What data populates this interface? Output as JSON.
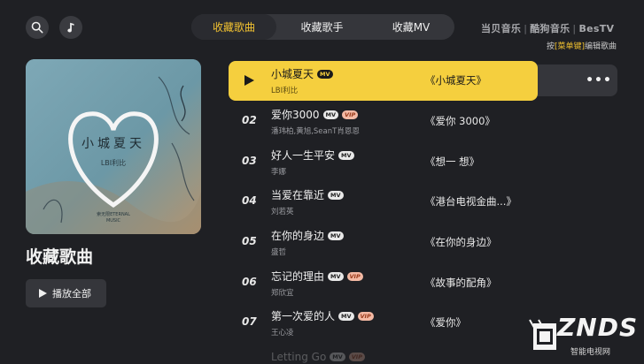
{
  "top": {
    "search_icon": "search-icon",
    "music_icon": "music-note-icon",
    "tabs": [
      {
        "label": "收藏歌曲",
        "active": true
      },
      {
        "label": "收藏歌手",
        "active": false
      },
      {
        "label": "收藏MV",
        "active": false
      }
    ],
    "brands": [
      "当贝音乐",
      "酷狗音乐",
      "BesTV"
    ],
    "hint_prefix": "按",
    "hint_key": "[菜单键]",
    "hint_suffix": "编辑歌曲"
  },
  "cover": {
    "text": "小城夏天",
    "artist": "LBI利比",
    "label_line1": "索无限ETERNAL",
    "label_line2": "MUSIC"
  },
  "sidebar": {
    "title": "收藏歌曲",
    "play_all": "播放全部"
  },
  "songs": [
    {
      "num": "",
      "title": "小城夏天",
      "mv": true,
      "vip": false,
      "artist": "LBI利比",
      "album": "《小城夏天》",
      "active": true
    },
    {
      "num": "02",
      "title": "爱你3000",
      "mv": true,
      "vip": true,
      "artist": "潘玮柏,黄旭,SeanT肖恩恩",
      "album": "《爱你 3000》",
      "active": false
    },
    {
      "num": "03",
      "title": "好人一生平安",
      "mv": true,
      "vip": false,
      "artist": "李娜",
      "album": "《想一 想》",
      "active": false
    },
    {
      "num": "04",
      "title": "当爱在靠近",
      "mv": true,
      "vip": false,
      "artist": "刘若英",
      "album": "《港台电视金曲...》",
      "active": false
    },
    {
      "num": "05",
      "title": "在你的身边",
      "mv": true,
      "vip": false,
      "artist": "盛哲",
      "album": "《在你的身边》",
      "active": false
    },
    {
      "num": "06",
      "title": "忘记的理由",
      "mv": true,
      "vip": true,
      "artist": "郑欣宜",
      "album": "《故事的配角》",
      "active": false
    },
    {
      "num": "07",
      "title": "第一次爱的人",
      "mv": true,
      "vip": true,
      "artist": "王心凌",
      "album": "《爱你》",
      "active": false
    },
    {
      "num": "",
      "title": "Letting Go",
      "mv": true,
      "vip": true,
      "artist": "",
      "album": "",
      "active": false
    }
  ],
  "badges": {
    "mv": "MV",
    "vip": "VIP"
  },
  "more_label": "•••",
  "watermark": {
    "logo": "ZNDS",
    "sub": "智能电视网"
  }
}
